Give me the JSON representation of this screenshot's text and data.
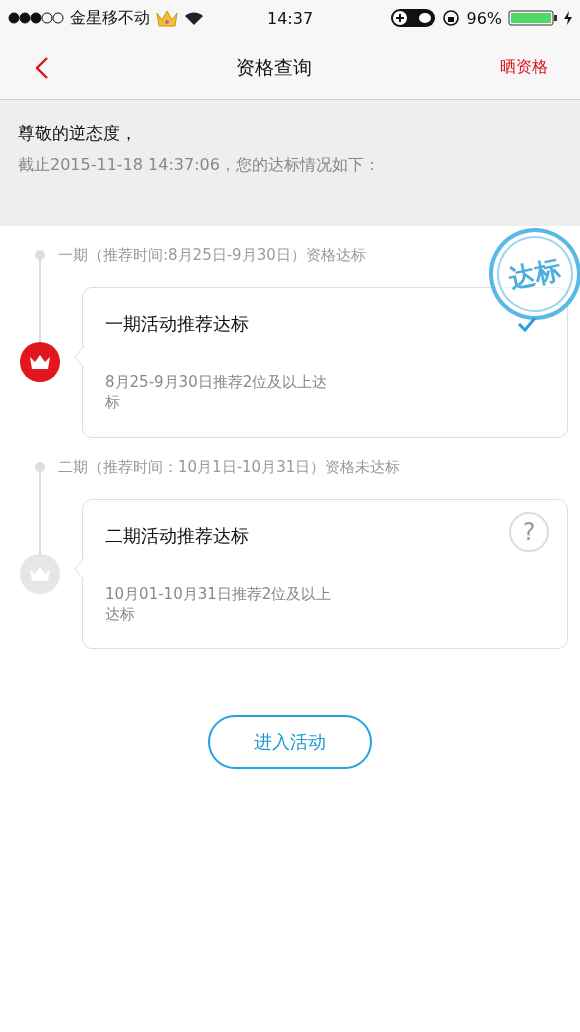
{
  "status_bar": {
    "carrier": "金星移不动",
    "time": "14:37",
    "battery": "96%"
  },
  "nav": {
    "title": "资格查询",
    "action": "晒资格"
  },
  "greeting": {
    "salutation": "尊敬的逆态度，",
    "summary": "截止2015-11-18 14:37:06，您的达标情况如下："
  },
  "periods": [
    {
      "header": "一期（推荐时间:8月25日-9月30日）资格达标",
      "title": "一期活动推荐达标",
      "description": "8月25-9月30日推荐2位及以上达标",
      "achieved": true,
      "stamp": "达标"
    },
    {
      "header": "二期（推荐时间：10月1日-10月31日）资格未达标",
      "title": "二期活动推荐达标",
      "description": "10月01-10月31日推荐2位及以上达标",
      "achieved": false,
      "badge": "?"
    }
  ],
  "enter_button": "进入活动"
}
